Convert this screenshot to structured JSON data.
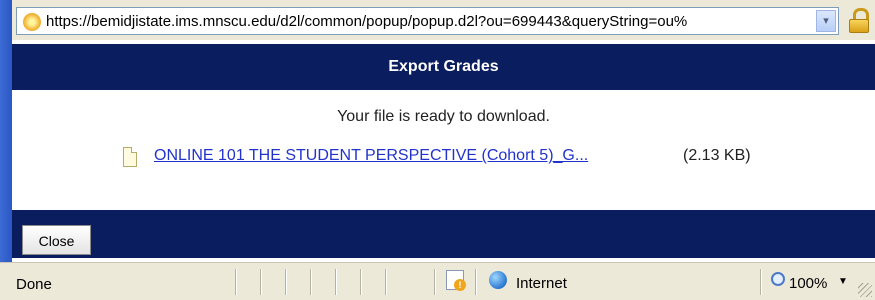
{
  "address_bar": {
    "url": "https://bemidjistate.ims.mnscu.edu/d2l/common/popup/popup.d2l?ou=699443&queryString=ou%",
    "dropdown_glyph": "▾",
    "site_icon": "site-favicon-icon",
    "security_icon": "lock-icon"
  },
  "dialog": {
    "title": "Export Grades",
    "message": "Your file is ready to download.",
    "file": {
      "icon": "document-icon",
      "name": "ONLINE 101 THE STUDENT PERSPECTIVE (Cohort 5)_G...",
      "size": "(2.13 KB)"
    },
    "close_label": "Close"
  },
  "status_bar": {
    "status": "Done",
    "zone_label": "Internet",
    "zoom": "100%",
    "zoom_caret": "▼",
    "icons": [
      "page-warning-icon",
      "globe-icon",
      "zoom-icon",
      "resize-grip-icon"
    ]
  },
  "colors": {
    "title_bar": "#0a1d5f",
    "link": "#2233cc",
    "chrome": "#ece9d8",
    "frame": "#2a57c2"
  }
}
